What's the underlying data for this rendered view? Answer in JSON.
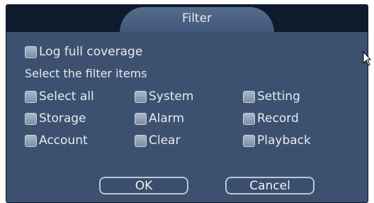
{
  "dialog": {
    "title": "Filter",
    "log_full_coverage": "Log full coverage",
    "filter_heading": "Select the filter items",
    "items": [
      {
        "label": "Select all"
      },
      {
        "label": "System"
      },
      {
        "label": "Setting"
      },
      {
        "label": "Storage"
      },
      {
        "label": "Alarm"
      },
      {
        "label": "Record"
      },
      {
        "label": "Account"
      },
      {
        "label": "Clear"
      },
      {
        "label": "Playback"
      }
    ],
    "ok_label": "OK",
    "cancel_label": "Cancel"
  },
  "colors": {
    "panel": "#3c5170",
    "titlebar": "#0f1b2c",
    "checkbox": "#a9b7c8",
    "text": "#e6ebf2"
  }
}
